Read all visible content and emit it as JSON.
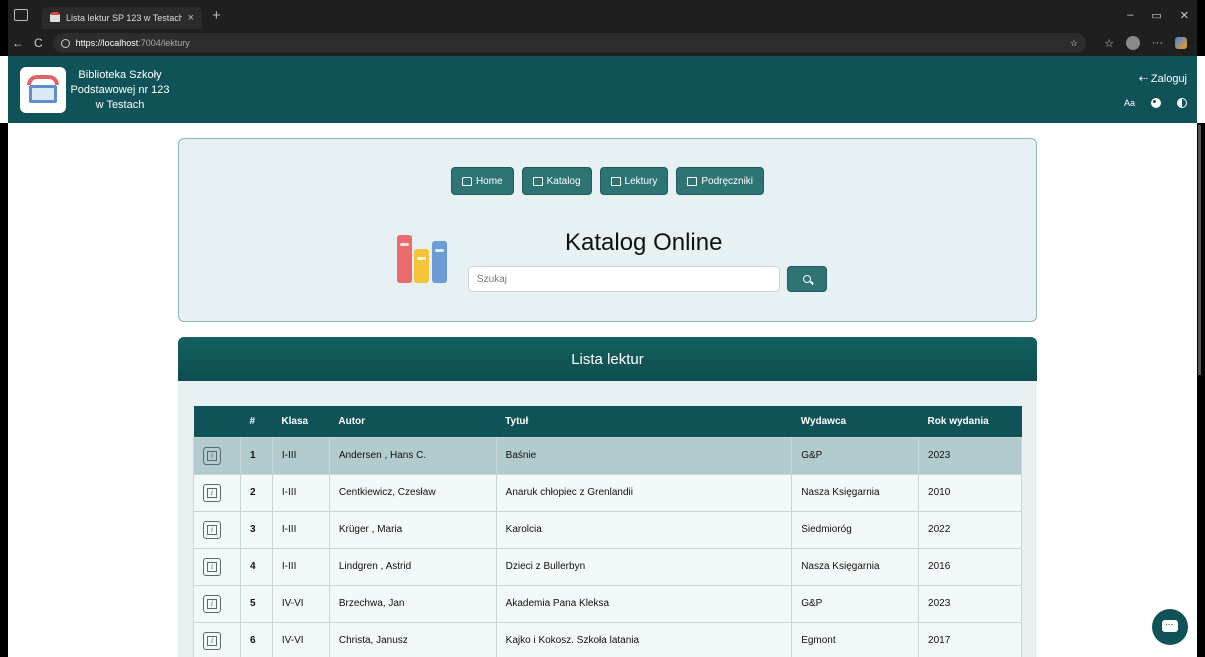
{
  "browser": {
    "tab_title": "Lista lektur SP 123 w Testach",
    "tab_close": "×",
    "new_tab": "+",
    "url_host": "https://localhost",
    "url_rest": ":7004/lektury",
    "back": "←",
    "reload": "C",
    "star": "☆",
    "favorites": "☆",
    "more": "···",
    "minimize": "–",
    "restore": "▭",
    "close": "✕"
  },
  "header": {
    "school_name": "Biblioteka Szkoły Podstawowej nr 123 w Testach",
    "login_icon": "⇠",
    "login_label": "Zaloguj",
    "font_size_label": "Aa"
  },
  "nav": {
    "home": "Home",
    "katalog": "Katalog",
    "lektury": "Lektury",
    "podreczniki": "Podręczniki"
  },
  "search": {
    "title": "Katalog Online",
    "placeholder": "Szukaj"
  },
  "list": {
    "title": "Lista lektur",
    "columns": [
      "",
      "#",
      "Klasa",
      "Autor",
      "Tytuł",
      "Wydawca",
      "Rok wydania"
    ],
    "rows": [
      {
        "num": "1",
        "klasa": "I-III",
        "autor": "Andersen , Hans C.",
        "tytul": "Baśnie",
        "wydawca": "G&P",
        "rok": "2023"
      },
      {
        "num": "2",
        "klasa": "I-III",
        "autor": "Centkiewicz, Czesław",
        "tytul": "Anaruk chłopiec z Grenlandii",
        "wydawca": "Nasza Księgarnia",
        "rok": "2010"
      },
      {
        "num": "3",
        "klasa": "I-III",
        "autor": "Krüger , Maria",
        "tytul": "Karolcia",
        "wydawca": "Siedmioróg",
        "rok": "2022"
      },
      {
        "num": "4",
        "klasa": "I-III",
        "autor": "Lindgren , Astrid",
        "tytul": "Dzieci z Bullerbyn",
        "wydawca": "Nasza Księgarnia",
        "rok": "2016"
      },
      {
        "num": "5",
        "klasa": "IV-VI",
        "autor": "Brzechwa, Jan",
        "tytul": "Akademia Pana Kleksa",
        "wydawca": "G&P",
        "rok": "2023"
      },
      {
        "num": "6",
        "klasa": "IV-VI",
        "autor": "Christa, Janusz",
        "tytul": "Kajko i Kokosz. Szkoła latania",
        "wydawca": "Egmont",
        "rok": "2017"
      }
    ]
  },
  "colors": {
    "brand": "#0f5257",
    "button": "#2e7475",
    "panel": "#e7f1f3",
    "row_highlight": "#b2cccd"
  }
}
